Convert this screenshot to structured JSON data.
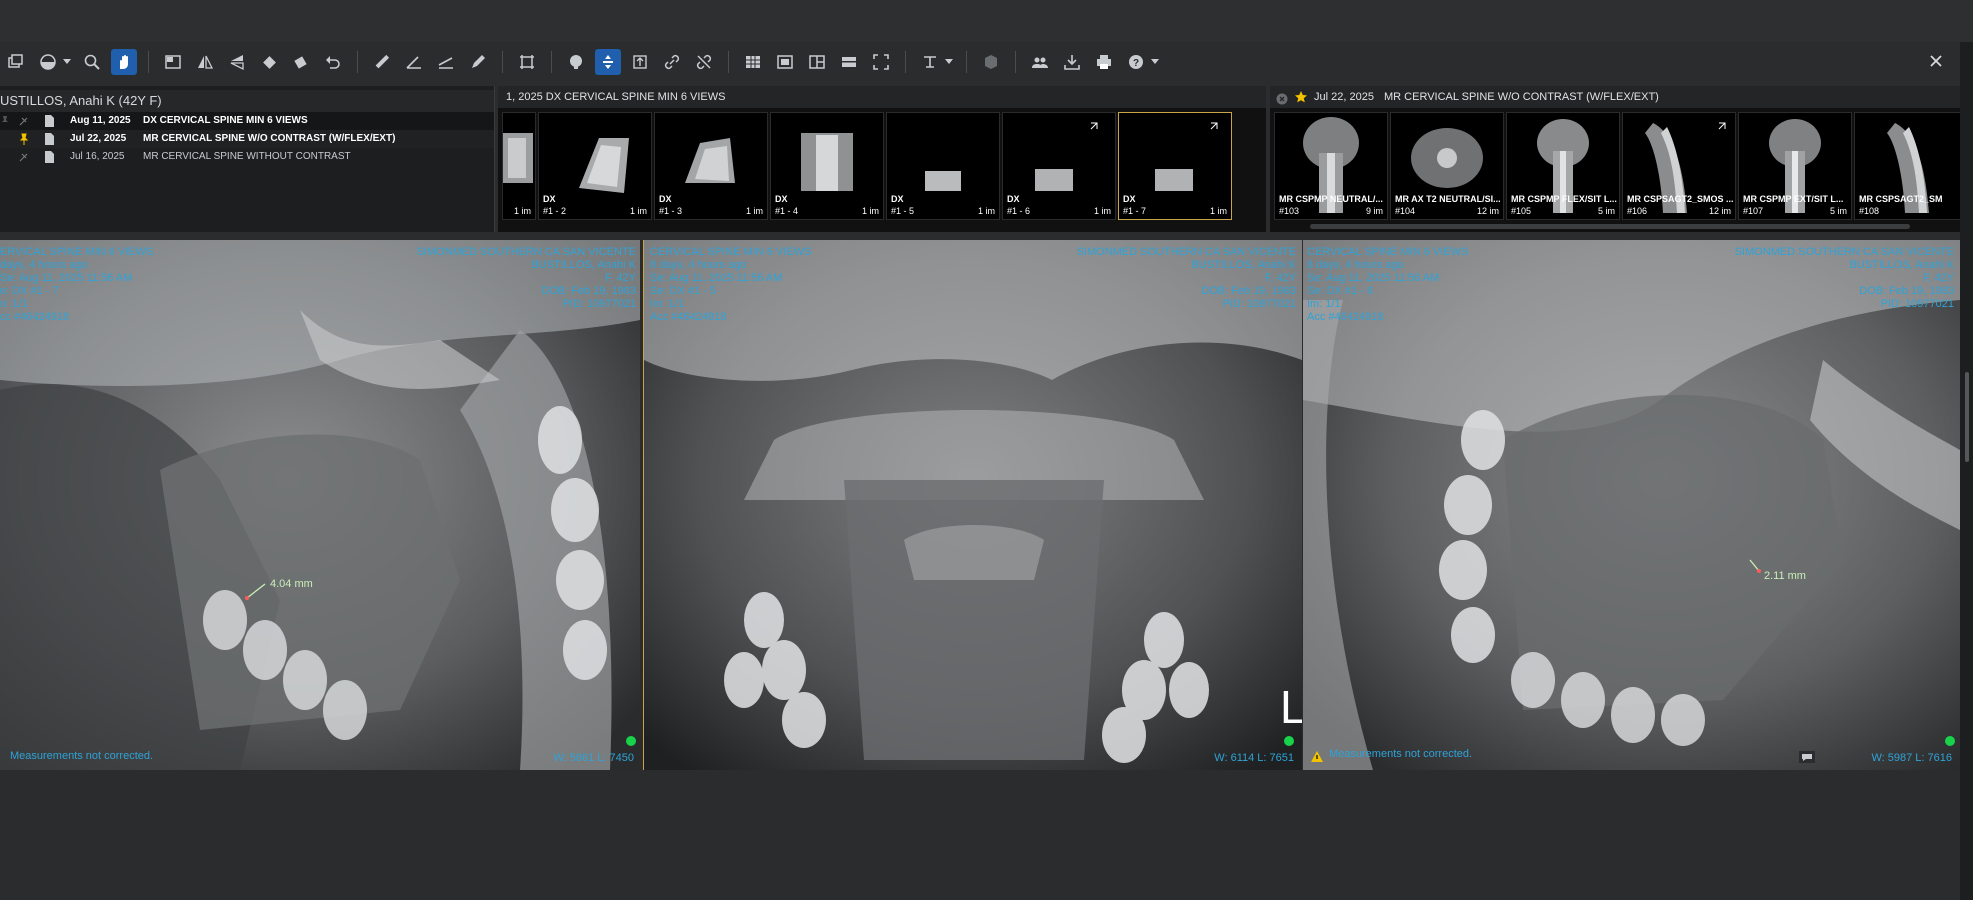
{
  "colors": {
    "accent": "#1f5fae",
    "overlay_text": "#2fa3d8",
    "measure_text": "#c9f0b8",
    "status_green": "#18d24a",
    "star": "#f2c200",
    "warning": "#f2c200"
  },
  "toolbar": {
    "icons": [
      "layers-icon",
      "contrast-icon",
      "zoom-icon",
      "pan-hand-icon",
      "layout-icon",
      "flip-horizontal-icon",
      "flip-vertical-icon",
      "rotate-left-icon",
      "rotate-right-icon",
      "undo-icon",
      "ruler-icon",
      "angle-icon",
      "line-icon",
      "pen-icon",
      "crop-icon",
      "palette-icon",
      "sync-scroll-icon",
      "stack-icon",
      "link-icon",
      "unlink-icon",
      "grid-icon",
      "series-layout-icon",
      "split-icon",
      "hanging-protocol-icon",
      "fullscreen-icon",
      "text-annotation-icon",
      "cube-icon",
      "users-icon",
      "download-icon",
      "print-icon",
      "help-icon",
      "close-icon"
    ]
  },
  "patient": {
    "name": "USTILLOS, Anahi K  (42Y F)"
  },
  "studies": [
    {
      "date": "Aug 11, 2025",
      "desc": "DX CERVICAL SPINE MIN 6 VIEWS",
      "bold": true
    },
    {
      "date": "Jul 22, 2025",
      "desc": "MR CERVICAL SPINE W/O CONTRAST (W/FLEX/EXT)",
      "bold": true
    },
    {
      "date": "Jul 16, 2025",
      "desc": "MR CERVICAL SPINE WITHOUT CONTRAST",
      "bold": false
    }
  ],
  "series_panel_dx": {
    "header": "1, 2025  DX CERVICAL SPINE MIN 6 VIEWS",
    "thumbs": [
      {
        "mod": "",
        "num": "",
        "count": "1 im"
      },
      {
        "mod": "DX",
        "num": "#1 - 2",
        "count": "1 im"
      },
      {
        "mod": "DX",
        "num": "#1 - 3",
        "count": "1 im"
      },
      {
        "mod": "DX",
        "num": "#1 - 4",
        "count": "1 im"
      },
      {
        "mod": "DX",
        "num": "#1 - 5",
        "count": "1 im"
      },
      {
        "mod": "DX",
        "num": "#1 - 6",
        "count": "1 im"
      },
      {
        "mod": "DX",
        "num": "#1 - 7",
        "count": "1 im"
      }
    ]
  },
  "series_panel_mr": {
    "header_date": "Jul 22, 2025",
    "header_desc": "MR CERVICAL SPINE W/O CONTRAST (W/FLEX/EXT)",
    "thumbs": [
      {
        "mod": "MR CSPMP NEUTRAL/...",
        "num": "#103",
        "count": "9 im"
      },
      {
        "mod": "MR AX T2 NEUTRAL/SI...",
        "num": "#104",
        "count": "12 im"
      },
      {
        "mod": "MR CSPMP FLEX/SIT L...",
        "num": "#105",
        "count": "5 im"
      },
      {
        "mod": "MR CSPSAGT2_SMOS ...",
        "num": "#106",
        "count": "12 im"
      },
      {
        "mod": "MR CSPMP EXT/SIT L...",
        "num": "#107",
        "count": "5 im"
      },
      {
        "mod": "MR CSPSAGT2_SM",
        "num": "#108",
        "count": ""
      }
    ]
  },
  "viewports": [
    {
      "title": "ERVICAL SPINE MIN 6 VIEWS",
      "l2": "days, 4 hours ago",
      "l3": "Se: Aug 11, 2025 11:56 AM",
      "l4": "e: DX #1 - 7",
      "l5": "n: 1/1",
      "l6": "cc #46424918",
      "inst": "SIMONMED SOUTHERN CA SAN VICENTE",
      "pname": "BUSTILLOS, Anahi K",
      "sex": "F, 42Y",
      "dob": "DOB: Feb 19, 1983",
      "pid": "PID: 10977021",
      "measure": "4.04 mm",
      "warn": "Measurements not corrected.",
      "wl": "W: 5861 L: 7450"
    },
    {
      "title": "CERVICAL SPINE MIN 6 VIEWS",
      "l2": "8 days, 4 hours ago",
      "l3": "Se: Aug 11, 2025 11:56 AM",
      "l4": "Se: DX #1 - 5",
      "l5": "Im: 1/1",
      "l6": "Acc #46424918",
      "inst": "SIMONMED SOUTHERN CA SAN VICENTE",
      "pname": "BUSTILLOS, Anahi K",
      "sex": "F, 42Y",
      "dob": "DOB: Feb 19, 1983",
      "pid": "PID: 10977021",
      "marker": "L",
      "wl": "W: 6114 L: 7651"
    },
    {
      "title": "CERVICAL SPINE MIN 6 VIEWS",
      "l2": "8 days, 4 hours ago",
      "l3": "Se: Aug 11, 2025 11:56 AM",
      "l4": "Se: DX #1 - 6",
      "l5": "Im: 1/1",
      "l6": "Acc #46424918",
      "inst": "SIMONMED SOUTHERN CA SAN VICENTE",
      "pname": "BUSTILLOS, Anahi K",
      "sex": "F, 42Y",
      "dob": "DOB: Feb 19, 1983",
      "pid": "PID: 10977021",
      "measure": "2.11 mm",
      "warn": "Measurements not corrected.",
      "wl": "W: 5987 L: 7616"
    }
  ]
}
